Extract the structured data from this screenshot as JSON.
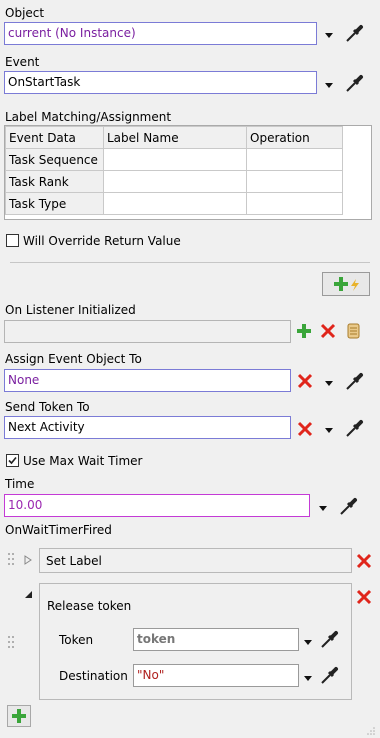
{
  "object": {
    "label": "Object",
    "value": "current (No Instance)"
  },
  "event": {
    "label": "Event",
    "value": "OnStartTask"
  },
  "label_matching": {
    "title": "Label Matching/Assignment",
    "headers": [
      "Event Data",
      "Label Name",
      "Operation"
    ],
    "rows": [
      [
        "Task Sequence",
        "",
        ""
      ],
      [
        "Task Rank",
        "",
        ""
      ],
      [
        "Task Type",
        "",
        ""
      ]
    ]
  },
  "will_override": {
    "label": "Will Override Return Value",
    "checked": false
  },
  "on_listener_initialized": {
    "label": "On Listener Initialized",
    "value": ""
  },
  "assign_event_object": {
    "label": "Assign Event Object To",
    "value": "None"
  },
  "send_token": {
    "label": "Send Token To",
    "value": "Next Activity"
  },
  "use_max_wait": {
    "label": "Use Max Wait Timer",
    "checked": true
  },
  "time": {
    "label": "Time",
    "value": "10.00"
  },
  "on_wait_timer_fired": {
    "label": "OnWaitTimerFired",
    "set_label": "Set Label",
    "release_token": {
      "title": "Release token",
      "token_label": "Token",
      "token_value": "token",
      "destination_label": "Destination",
      "destination_value": "\"No\""
    }
  },
  "icons": {
    "picker": "eyedropper-icon",
    "add": "plus-icon",
    "remove": "x-icon",
    "code": "scroll-icon",
    "dropdown": "chevron-down-icon"
  },
  "colors": {
    "add_green": "#3aa53a",
    "remove_red": "#e0251b",
    "field_border": "#7b7bd6",
    "purple_text": "#7a1fa0"
  }
}
